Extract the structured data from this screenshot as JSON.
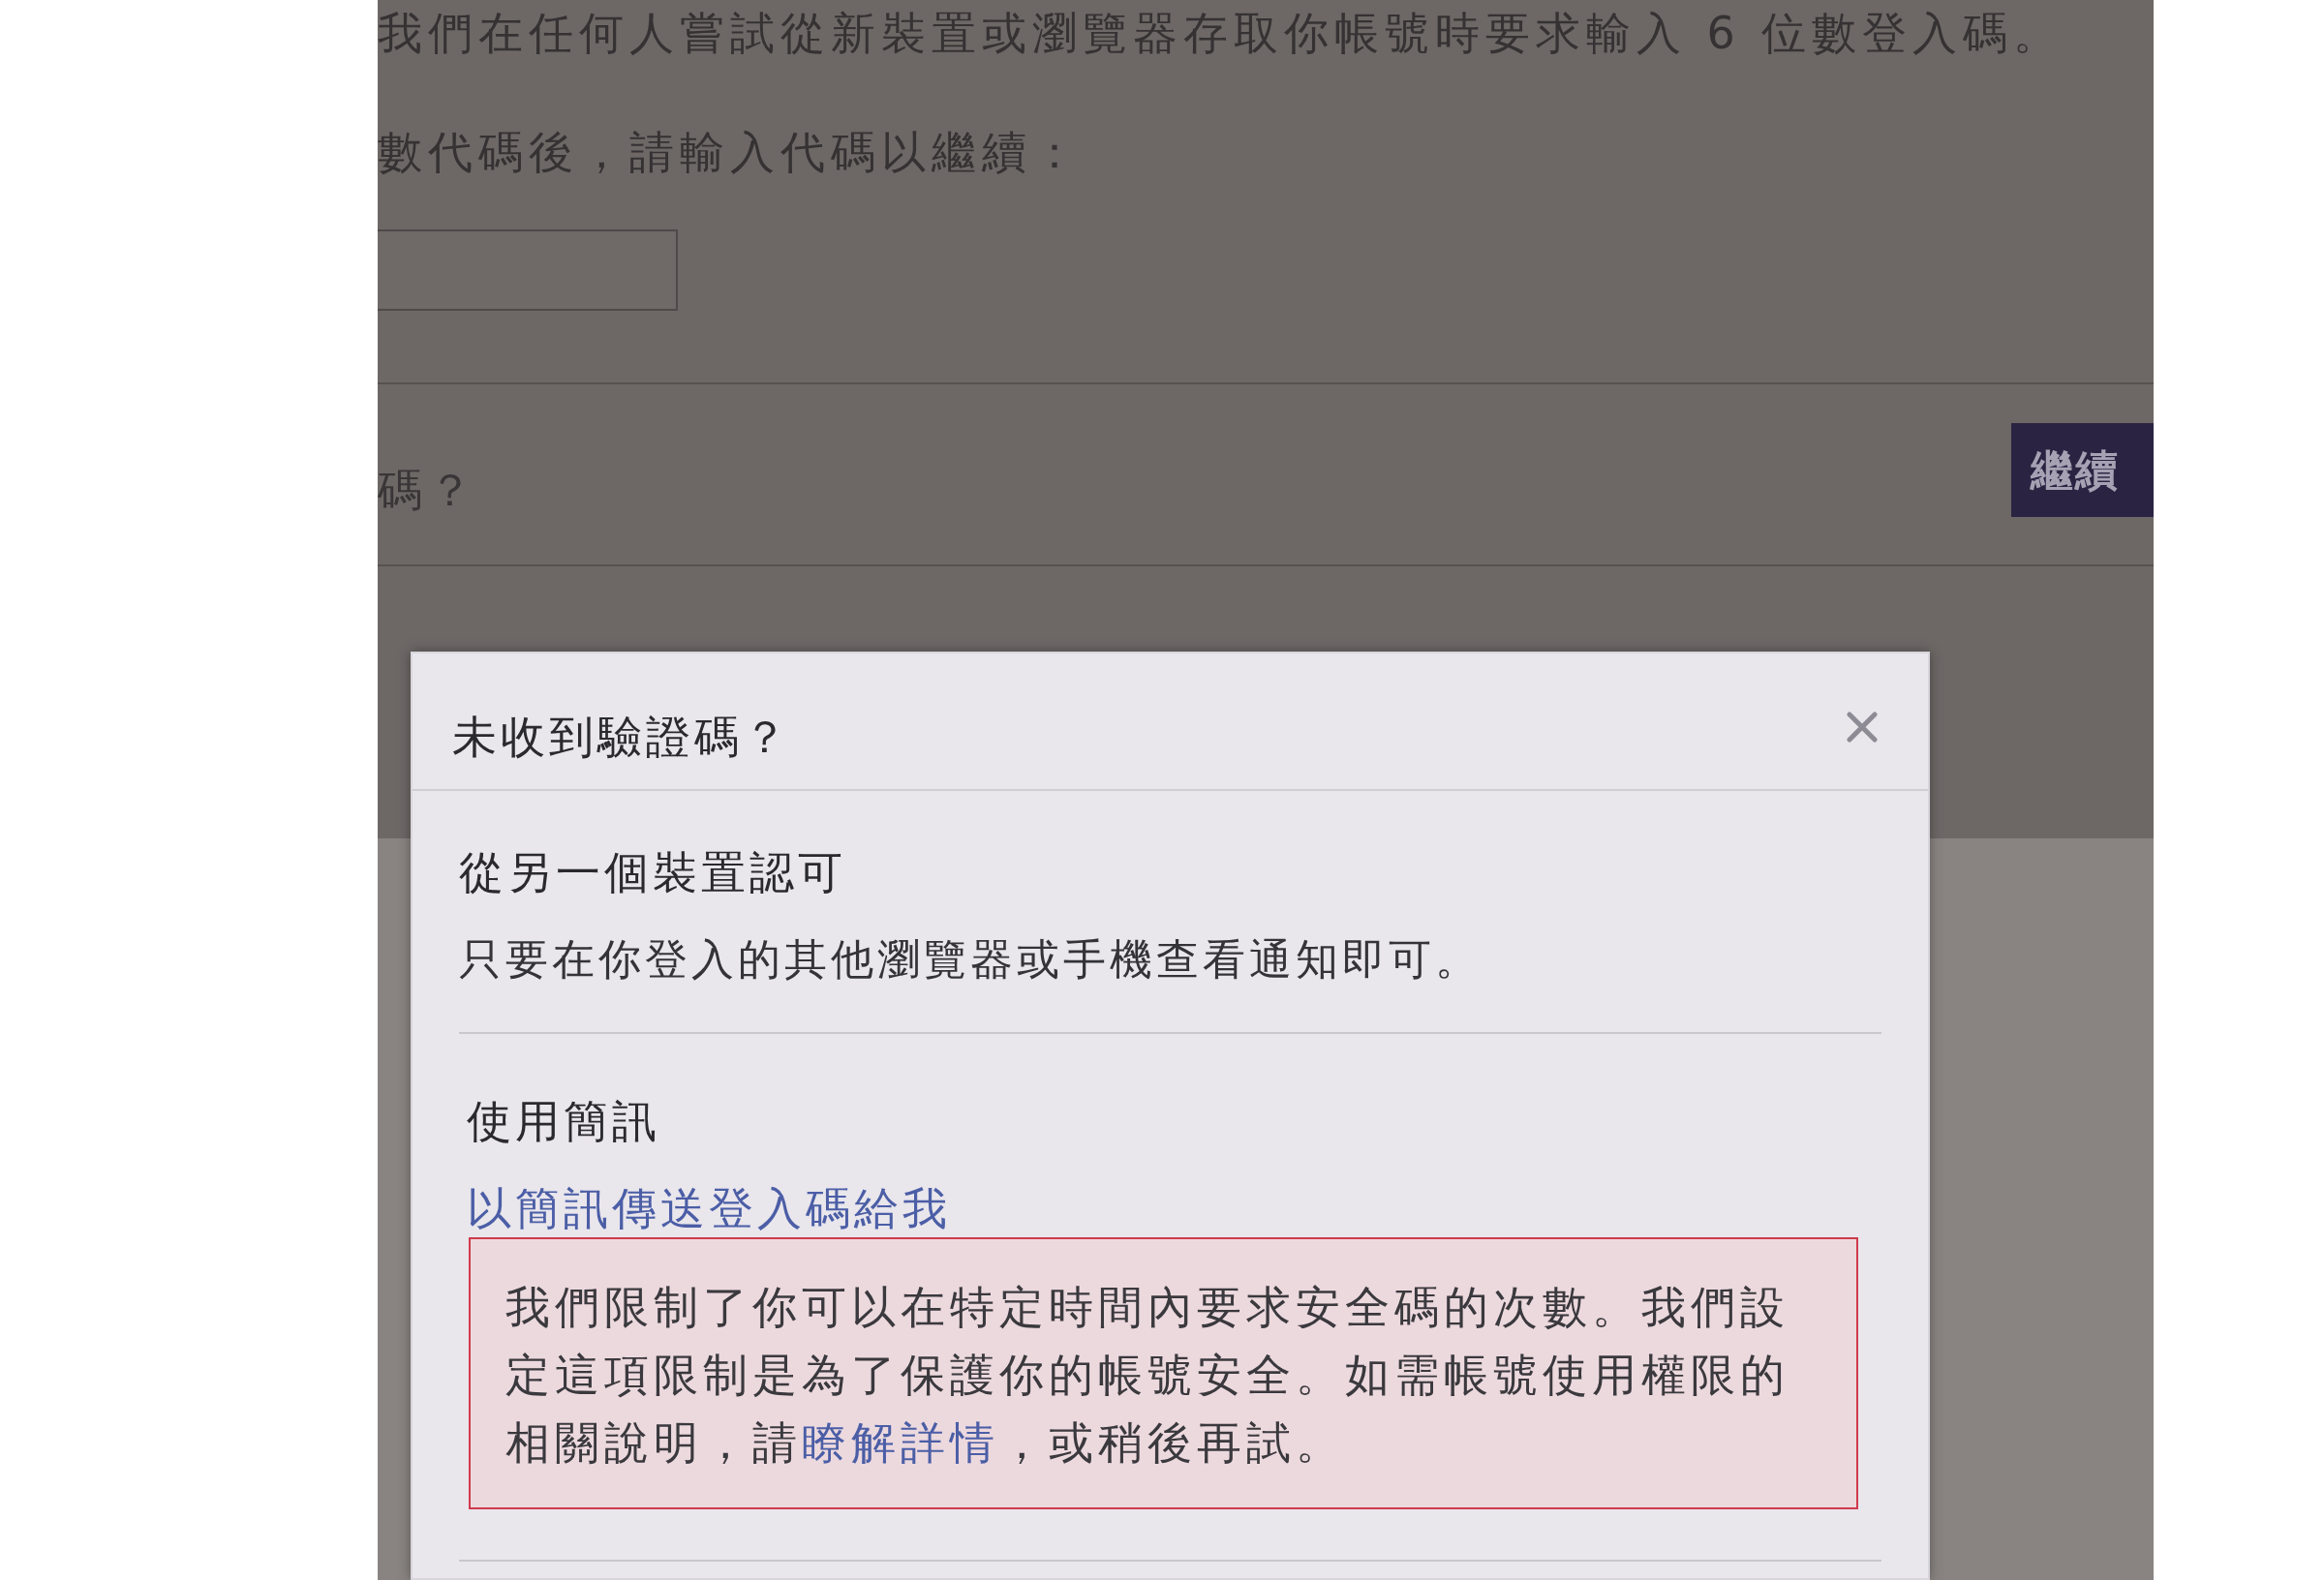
{
  "background_page": {
    "description_lines": [
      "我們在任何人嘗試從新裝置或瀏覽器存取你帳號時要求輸入 6 位數登入碼。",
      "數代碼後，請輸入代碼以繼續："
    ],
    "help_link": "碼？",
    "continue_button": "繼續"
  },
  "dialog": {
    "title": "未收到驗證碼？",
    "sections": [
      {
        "kind": "text",
        "heading": "從另一個裝置認可",
        "body": "只要在你登入的其他瀏覽器或手機查看通知即可。"
      },
      {
        "kind": "link",
        "heading": "使用簡訊",
        "body": "以簡訊傳送登入碼給我",
        "error": {
          "text_before": "我們限制了你可以在特定時間內要求安全碼的次數。我們設定這項限制是為了保護你的帳號安全。如需帳號使用權限的相關說明，請",
          "link": "瞭解詳情",
          "text_after": "，或稍後再試。"
        }
      }
    ]
  }
}
